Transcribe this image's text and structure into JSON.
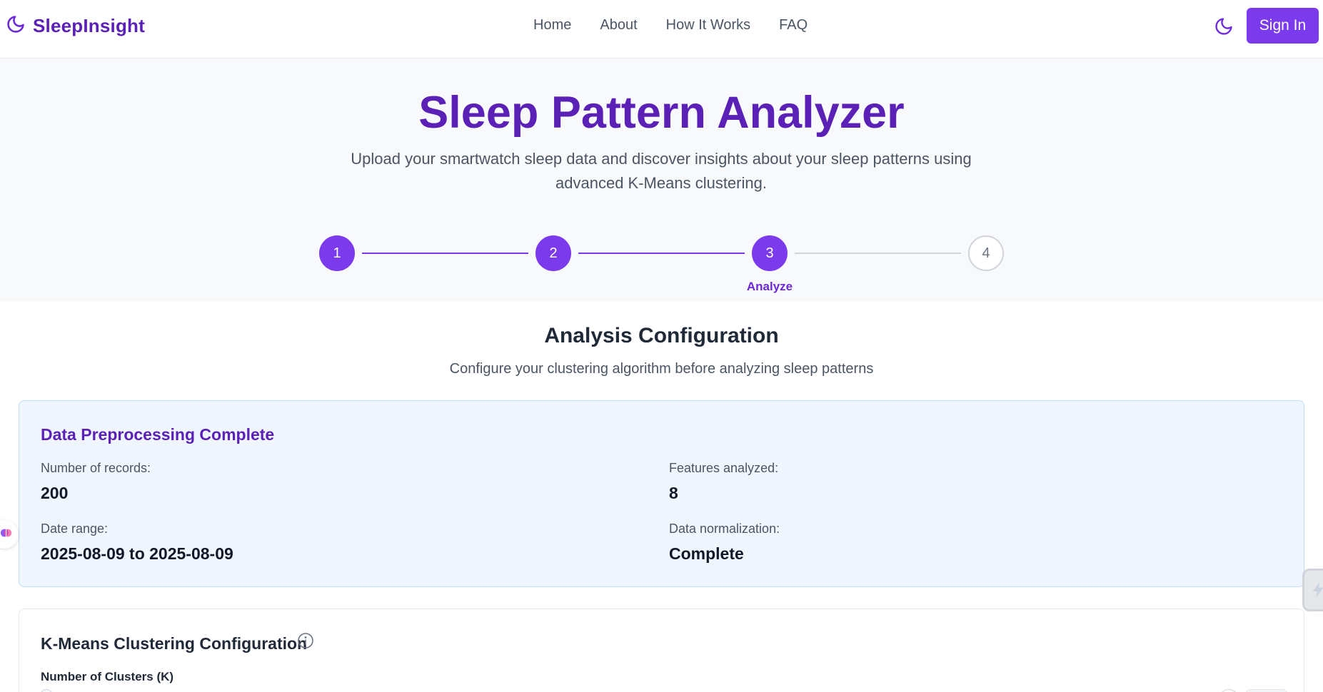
{
  "navbar": {
    "brand": "SleepInsight",
    "links": [
      "Home",
      "About",
      "How It Works",
      "FAQ"
    ],
    "sign_in": "Sign In"
  },
  "hero": {
    "title": "Sleep Pattern Analyzer",
    "subtitle": "Upload your smartwatch sleep data and discover insights about your sleep patterns using advanced K-Means clustering."
  },
  "stepper": {
    "steps": [
      "1",
      "2",
      "3",
      "4"
    ],
    "current_step": 3,
    "current_label": "Analyze"
  },
  "section": {
    "title": "Analysis Configuration",
    "subtitle": "Configure your clustering algorithm before analyzing sleep patterns"
  },
  "preprocessing": {
    "title": "Data Preprocessing Complete",
    "records_label": "Number of records:",
    "records_value": "200",
    "features_label": "Features analyzed:",
    "features_value": "8",
    "date_label": "Date range:",
    "date_value": "2025-08-09 to 2025-08-09",
    "normalization_label": "Data normalization:",
    "normalization_value": "Complete"
  },
  "config": {
    "title": "K-Means Clustering Configuration",
    "clusters_label": "Number of Clusters (K)"
  },
  "colors": {
    "primary": "#7c3aed",
    "brand_text": "#5b21b6",
    "info_card_bg": "#eff6ff"
  }
}
